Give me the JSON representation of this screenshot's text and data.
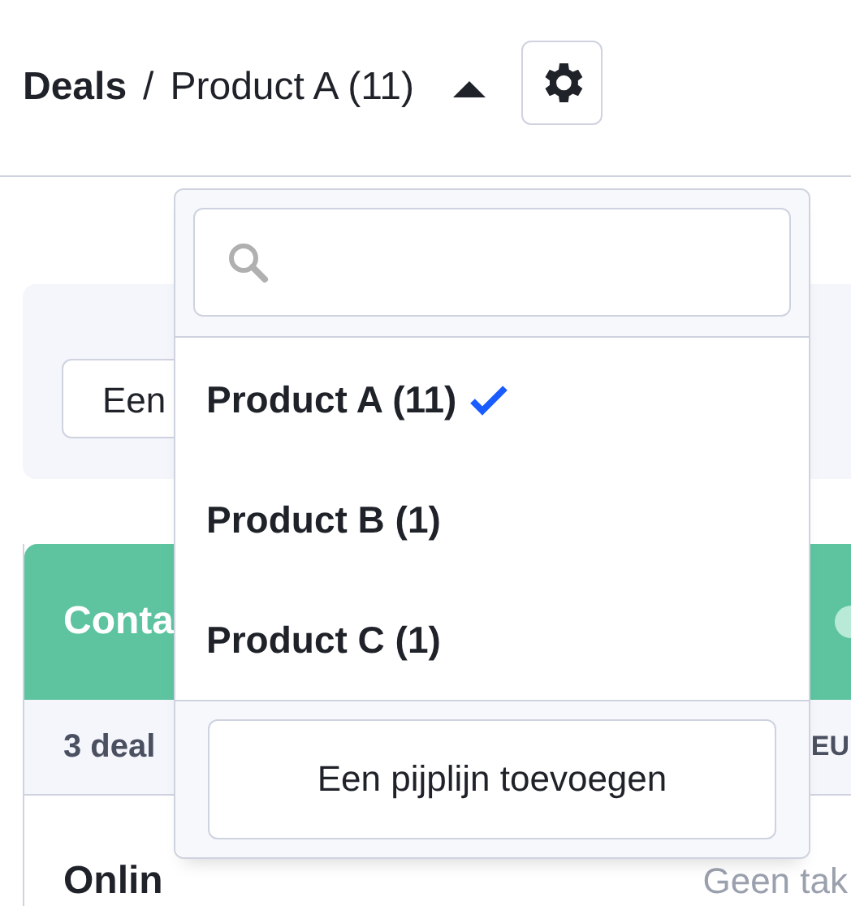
{
  "header": {
    "title": "Deals",
    "separator": "/",
    "pipeline": "Product A (11)",
    "expanded": true
  },
  "background": {
    "filter_field": "Een",
    "column_title": "Conta",
    "deal_count": "3 deal",
    "currency": "EU",
    "deal_title": "Onlin",
    "deal_status": "Geen tak"
  },
  "dropdown": {
    "items": [
      {
        "label": "Product A (11)",
        "selected": true
      },
      {
        "label": "Product B (1)",
        "selected": false
      },
      {
        "label": "Product C (1)",
        "selected": false
      }
    ],
    "add_button": "Een pijplijn toevoegen"
  }
}
